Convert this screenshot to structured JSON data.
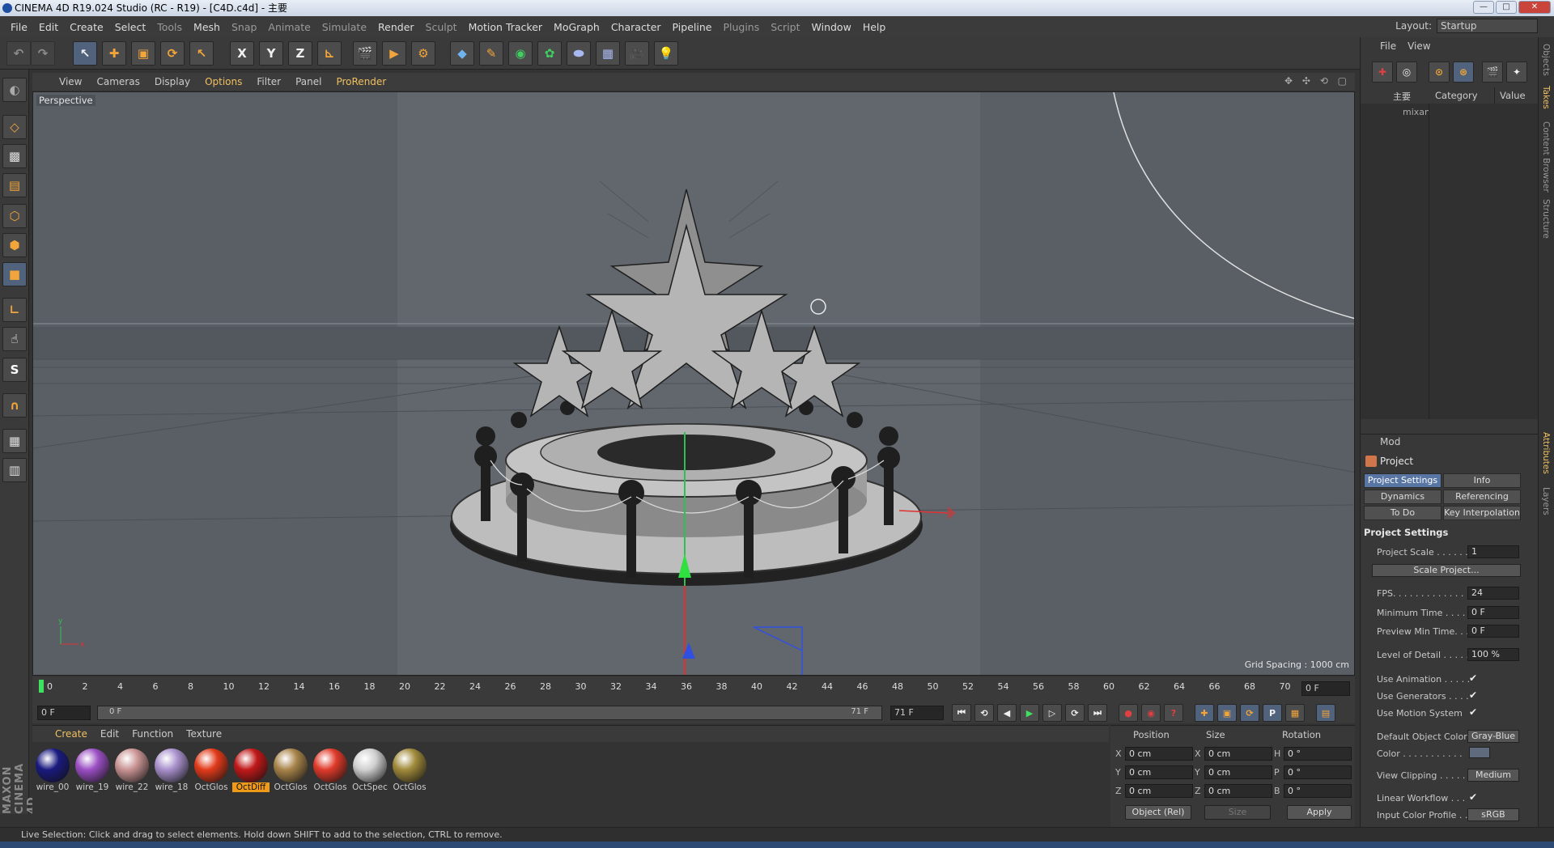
{
  "window": {
    "title": "CINEMA 4D R19.024 Studio (RC - R19) - [C4D.c4d] - 主要",
    "controls": [
      "—",
      "□",
      "✕"
    ]
  },
  "menubar": {
    "items": [
      "File",
      "Edit",
      "Create",
      "Select",
      "Tools",
      "Mesh",
      "Snap",
      "Animate",
      "Simulate",
      "Render",
      "Sculpt",
      "Motion Tracker",
      "MoGraph",
      "Character",
      "Pipeline",
      "Plugins",
      "Script",
      "Window",
      "Help"
    ],
    "layout_label": "Layout:",
    "layout_value": "Startup"
  },
  "toolbar": {
    "axis_x": "X",
    "axis_y": "Y",
    "axis_z": "Z"
  },
  "viewport": {
    "menu": [
      "View",
      "Cameras",
      "Display",
      "Options",
      "Filter",
      "Panel",
      "ProRender"
    ],
    "label": "Perspective",
    "grid_spacing": "Grid Spacing : 1000 cm"
  },
  "timeline": {
    "ticks": [
      "0",
      "2",
      "4",
      "6",
      "8",
      "10",
      "12",
      "14",
      "16",
      "18",
      "20",
      "22",
      "24",
      "26",
      "28",
      "30",
      "32",
      "34",
      "36",
      "38",
      "40",
      "42",
      "44",
      "46",
      "48",
      "50",
      "52",
      "54",
      "56",
      "58",
      "60",
      "62",
      "64",
      "66",
      "68",
      "70"
    ],
    "current_frame": "0 F",
    "start_frame": "0 F",
    "range_start": "0 F",
    "range_end": "71 F",
    "end_frame": "71 F"
  },
  "materials": {
    "menu": [
      "Create",
      "Edit",
      "Function",
      "Texture"
    ],
    "items": [
      {
        "label": "wire_00",
        "color": "#1a1a80"
      },
      {
        "label": "wire_19",
        "color": "#9b4fc4"
      },
      {
        "label": "wire_22",
        "color": "#c99393"
      },
      {
        "label": "wire_18",
        "color": "#a890cc"
      },
      {
        "label": "OctGlos",
        "color": "#e23a1a"
      },
      {
        "label": "OctDiff",
        "color": "#c01818"
      },
      {
        "label": "OctGlos",
        "color": "#a8844a"
      },
      {
        "label": "OctGlos",
        "color": "#e03a2a"
      },
      {
        "label": "OctSpec",
        "color": "#d0d0d0"
      },
      {
        "label": "OctGlos",
        "color": "#a08a3a"
      }
    ],
    "selected_index": 5
  },
  "coords": {
    "headers": [
      "Position",
      "Size",
      "Rotation"
    ],
    "rows": [
      {
        "pl": "X",
        "pv": "0 cm",
        "sl": "X",
        "sv": "0 cm",
        "rl": "H",
        "rv": "0 °"
      },
      {
        "pl": "Y",
        "pv": "0 cm",
        "sl": "Y",
        "sv": "0 cm",
        "rl": "P",
        "rv": "0 °"
      },
      {
        "pl": "Z",
        "pv": "0 cm",
        "sl": "Z",
        "sv": "0 cm",
        "rl": "B",
        "rv": "0 °"
      }
    ],
    "mode": "Object (Rel)",
    "size_mode": "Size",
    "apply": "Apply"
  },
  "status": "Live Selection: Click and drag to select elements. Hold down SHIFT to add to the selection, CTRL to remove.",
  "objects": {
    "menu": [
      "File",
      "View"
    ],
    "tree_root": "主要",
    "tree_child": "mixan",
    "columns": [
      "Category",
      "Value"
    ]
  },
  "side_tabs": [
    "Objects",
    "Takes",
    "Content Browser",
    "Structure",
    "Attributes",
    "Layers"
  ],
  "attributes": {
    "mode": "Mod",
    "title": "Project",
    "tabs": [
      "Project Settings",
      "Info",
      "Dynamics",
      "Referencing",
      "To Do",
      "Key Interpolation"
    ],
    "section": "Project Settings",
    "rows": {
      "project_scale": {
        "label": "Project Scale . . . . . .",
        "value": "1"
      },
      "scale_project": "Scale Project...",
      "fps": {
        "label": "FPS. . . . . . . . . . . . . .",
        "value": "24"
      },
      "min_time": {
        "label": "Minimum Time . . . . .",
        "value": "0 F"
      },
      "preview_min": {
        "label": "Preview Min Time. . .",
        "value": "0 F"
      },
      "lod": {
        "label": "Level of Detail . . . . .",
        "value": "100 %"
      },
      "use_animation": "Use Animation . . . . .",
      "use_generators": "Use Generators . . . .",
      "use_motion": "Use Motion System",
      "default_color": {
        "label": "Default Object Color",
        "value": "Gray-Blue"
      },
      "color": "Color . . . . . . . . . . .",
      "view_clipping": {
        "label": "View Clipping . . . . .",
        "value": "Medium"
      },
      "linear_workflow": "Linear Workflow . . .",
      "input_profile": {
        "label": "Input Color Profile . .",
        "value": "sRGB"
      }
    },
    "check": "✔"
  }
}
